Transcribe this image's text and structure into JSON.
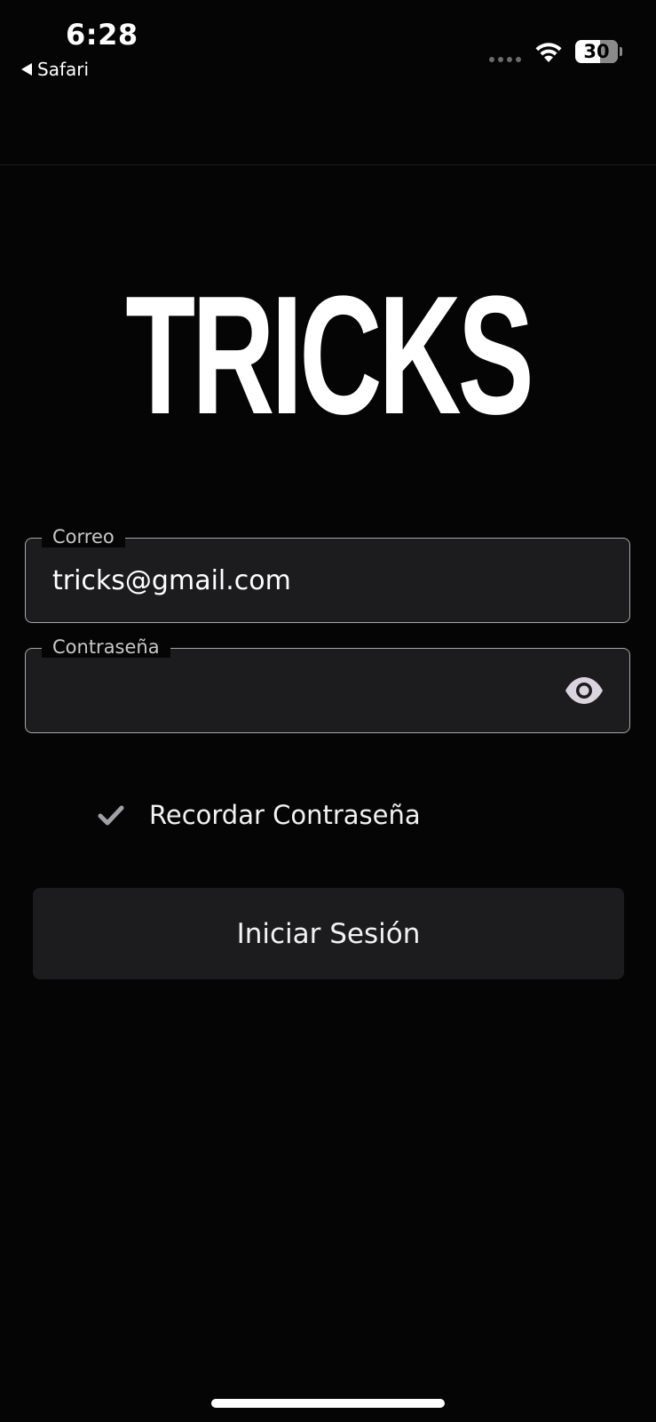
{
  "status_bar": {
    "time": "6:28",
    "back_app": "Safari",
    "battery": "30"
  },
  "app": {
    "logo_text": "TRICKS"
  },
  "form": {
    "email": {
      "label": "Correo",
      "value": "tricks@gmail.com"
    },
    "password": {
      "label": "Contraseña",
      "value": ""
    },
    "remember_label": "Recordar Contraseña",
    "remember_checked": true,
    "submit_label": "Iniciar Sesión"
  },
  "colors": {
    "background": "#050505",
    "field_background": "#1c1c1e",
    "field_border": "#a8a8a8",
    "text": "#ffffff"
  },
  "icons": {
    "back": "back-triangle-icon",
    "wifi": "wifi-icon",
    "battery": "battery-icon",
    "signal": "signal-dots-icon",
    "eye": "eye-icon",
    "check": "check-icon"
  }
}
